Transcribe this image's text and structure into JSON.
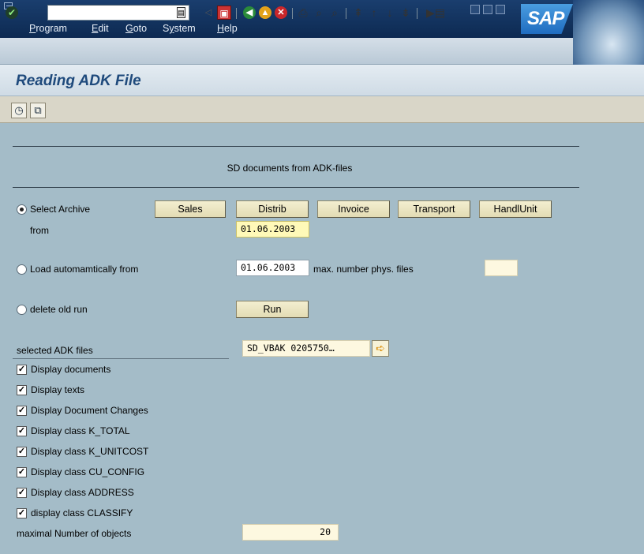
{
  "menu": {
    "items": [
      "Program",
      "Edit",
      "Goto",
      "System",
      "Help"
    ],
    "underline": [
      "P",
      "E",
      "G",
      "y",
      "H"
    ]
  },
  "brand": {
    "logo_text": "SAP"
  },
  "toolbar": {
    "command_value": "",
    "icons": [
      "enter-icon",
      "save-icon",
      "back-icon",
      "exit-icon",
      "cancel-icon",
      "print-icon",
      "find-icon",
      "find-next-icon",
      "first-page-icon",
      "previous-page-icon",
      "next-page-icon",
      "last-page-icon",
      "create-session-icon"
    ]
  },
  "page": {
    "title": "Reading ADK File"
  },
  "app_toolbar": {
    "icons": [
      "execute-clock-icon",
      "copy-variant-icon"
    ]
  },
  "form": {
    "section_title": "SD documents from ADK-files",
    "select_archive_label": "Select Archive",
    "from_label": "from",
    "from_value": "01.06.2003",
    "archive_buttons": [
      "Sales",
      "Distrib",
      "Invoice",
      "Transport",
      "HandlUnit"
    ],
    "load_auto_label": "Load automamtically from",
    "load_auto_value": "01.06.2003",
    "max_phys_files_label": "max. number phys. files",
    "max_phys_files_value": "",
    "delete_old_run_label": "delete old run",
    "run_button": "Run",
    "selected_adk_label": "selected ADK files",
    "selected_adk_value": "SD_VBAK    0205750…",
    "checkboxes": [
      {
        "label": "Display documents",
        "checked": true
      },
      {
        "label": "Display texts",
        "checked": true
      },
      {
        "label": "Display Document Changes",
        "checked": true
      },
      {
        "label": "Display class K_TOTAL",
        "checked": true
      },
      {
        "label": "Display class K_UNITCOST",
        "checked": true
      },
      {
        "label": "Display class CU_CONFIG",
        "checked": true
      },
      {
        "label": "Display class ADDRESS",
        "checked": true
      },
      {
        "label": "display class CLASSIFY",
        "checked": true
      }
    ],
    "max_objects_label": "maximal Number of objects",
    "max_objects_value": "20",
    "selected_radio": "select_archive"
  }
}
